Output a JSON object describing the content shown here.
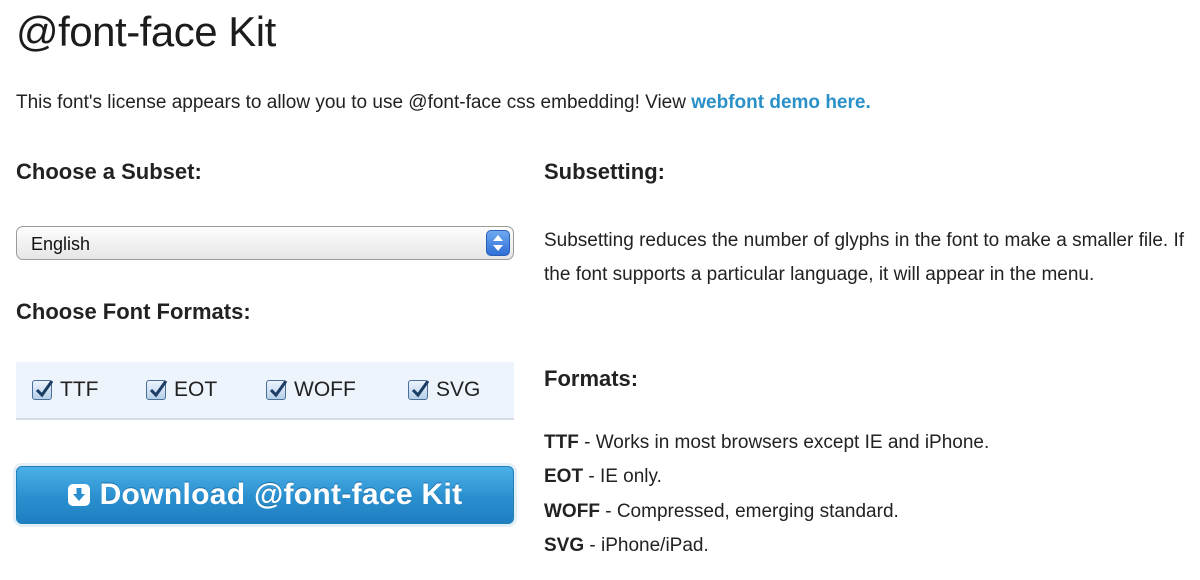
{
  "page": {
    "title": "@font-face Kit",
    "license_text": "This font's license appears to allow you to use @font-face css embedding! View ",
    "license_link": "webfont demo here."
  },
  "left": {
    "subset_heading": "Choose a Subset:",
    "subset_selected": "English",
    "formats_heading": "Choose Font Formats:",
    "formats": [
      {
        "label": "TTF",
        "checked": true
      },
      {
        "label": "EOT",
        "checked": true
      },
      {
        "label": "WOFF",
        "checked": true
      },
      {
        "label": "SVG",
        "checked": true
      }
    ],
    "download_label": "Download @font-face Kit"
  },
  "right": {
    "subsetting_heading": "Subsetting:",
    "subsetting_text": "Subsetting reduces the number of glyphs in the font to make a smaller file. If the font supports a particular language, it will appear in the menu.",
    "formats_heading": "Formats:",
    "format_notes": [
      {
        "name": "TTF",
        "desc": " - Works in most browsers except IE and iPhone."
      },
      {
        "name": "EOT",
        "desc": " - IE only."
      },
      {
        "name": "WOFF",
        "desc": " - Compressed, emerging standard."
      },
      {
        "name": "SVG",
        "desc": " - iPhone/iPad."
      }
    ]
  },
  "colors": {
    "link": "#2a90c8",
    "button": "#2a8fcf",
    "formats_box": "#eef4fb"
  },
  "icons": {
    "select_arrows": "updown-arrows-icon",
    "checkbox": "checkmark-icon",
    "download": "download-arrow-icon"
  }
}
